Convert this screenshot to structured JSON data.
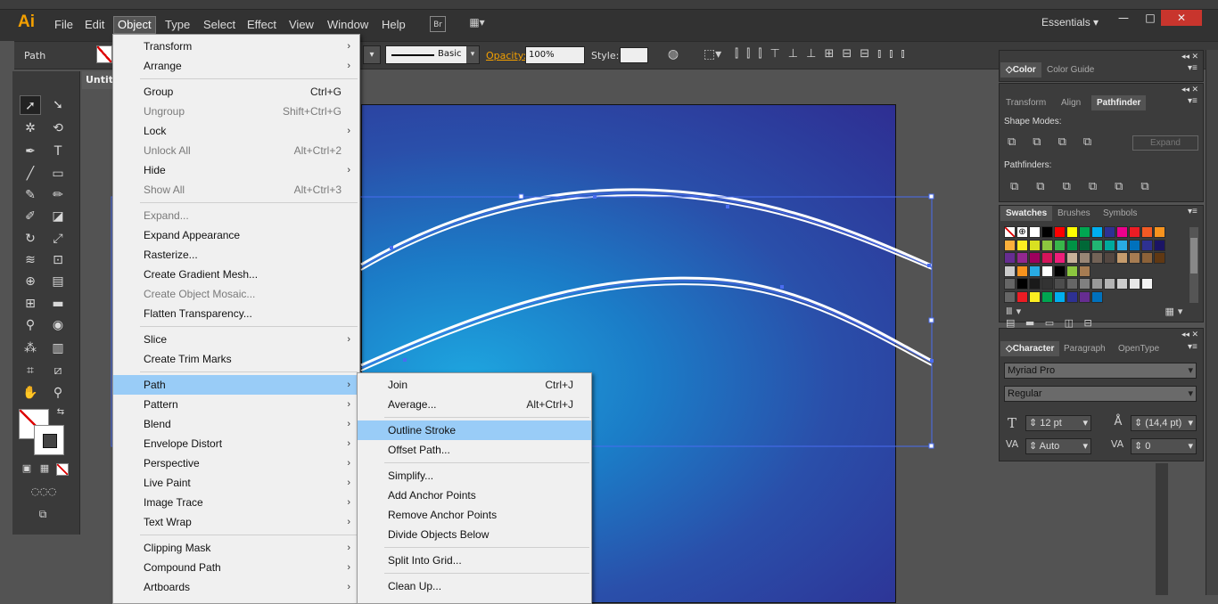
{
  "app": {
    "logo": "Ai",
    "workspace": "Essentials"
  },
  "menubar": {
    "items": [
      "File",
      "Edit",
      "Object",
      "Type",
      "Select",
      "Effect",
      "View",
      "Window",
      "Help"
    ],
    "active": "Object"
  },
  "window_controls": {
    "minimize": "—",
    "maximize": "□",
    "close": "✕"
  },
  "control_bar": {
    "selection_label": "Path",
    "stroke_style": "Basic",
    "opacity_label": "Opacity:",
    "opacity_value": "100%",
    "style_label": "Style:"
  },
  "document": {
    "tab_title": "Untitl"
  },
  "object_menu": [
    {
      "label": "Transform",
      "submenu": true
    },
    {
      "label": "Arrange",
      "submenu": true
    },
    {
      "sep": true
    },
    {
      "label": "Group",
      "shortcut": "Ctrl+G"
    },
    {
      "label": "Ungroup",
      "shortcut": "Shift+Ctrl+G",
      "disabled": true
    },
    {
      "label": "Lock",
      "submenu": true
    },
    {
      "label": "Unlock All",
      "shortcut": "Alt+Ctrl+2",
      "disabled": true
    },
    {
      "label": "Hide",
      "submenu": true
    },
    {
      "label": "Show All",
      "shortcut": "Alt+Ctrl+3",
      "disabled": true
    },
    {
      "sep": true
    },
    {
      "label": "Expand...",
      "disabled": true
    },
    {
      "label": "Expand Appearance"
    },
    {
      "label": "Rasterize..."
    },
    {
      "label": "Create Gradient Mesh..."
    },
    {
      "label": "Create Object Mosaic...",
      "disabled": true
    },
    {
      "label": "Flatten Transparency..."
    },
    {
      "sep": true
    },
    {
      "label": "Slice",
      "submenu": true
    },
    {
      "label": "Create Trim Marks"
    },
    {
      "sep": true
    },
    {
      "label": "Path",
      "submenu": true,
      "highlighted": true
    },
    {
      "label": "Pattern",
      "submenu": true
    },
    {
      "label": "Blend",
      "submenu": true
    },
    {
      "label": "Envelope Distort",
      "submenu": true
    },
    {
      "label": "Perspective",
      "submenu": true
    },
    {
      "label": "Live Paint",
      "submenu": true
    },
    {
      "label": "Image Trace",
      "submenu": true
    },
    {
      "label": "Text Wrap",
      "submenu": true
    },
    {
      "sep": true
    },
    {
      "label": "Clipping Mask",
      "submenu": true
    },
    {
      "label": "Compound Path",
      "submenu": true
    },
    {
      "label": "Artboards",
      "submenu": true
    }
  ],
  "path_submenu": [
    {
      "label": "Join",
      "shortcut": "Ctrl+J"
    },
    {
      "label": "Average...",
      "shortcut": "Alt+Ctrl+J"
    },
    {
      "sep": true
    },
    {
      "label": "Outline Stroke",
      "highlighted": true
    },
    {
      "label": "Offset Path..."
    },
    {
      "sep": true
    },
    {
      "label": "Simplify..."
    },
    {
      "label": "Add Anchor Points"
    },
    {
      "label": "Remove Anchor Points"
    },
    {
      "label": "Divide Objects Below"
    },
    {
      "sep": true
    },
    {
      "label": "Split Into Grid..."
    },
    {
      "sep": true
    },
    {
      "label": "Clean Up..."
    }
  ],
  "panels": {
    "color": {
      "tabs": [
        "Color",
        "Color Guide"
      ]
    },
    "pathfinder": {
      "tabs": [
        "Transform",
        "Align",
        "Pathfinder"
      ],
      "shape_modes": "Shape Modes:",
      "expand": "Expand",
      "pathfinders": "Pathfinders:"
    },
    "swatches": {
      "tabs": [
        "Swatches",
        "Brushes",
        "Symbols"
      ]
    },
    "character": {
      "tabs": [
        "Character",
        "Paragraph",
        "OpenType"
      ],
      "font": "Myriad Pro",
      "style": "Regular",
      "size": "12 pt",
      "leading": "(14,4 pt)",
      "kerning": "Auto",
      "tracking": "0"
    }
  },
  "colors": {
    "menubar": "#323232",
    "menu_bg": "#f0f0f0",
    "highlight": "#99ccf7",
    "selection": "#4a6cf0"
  }
}
